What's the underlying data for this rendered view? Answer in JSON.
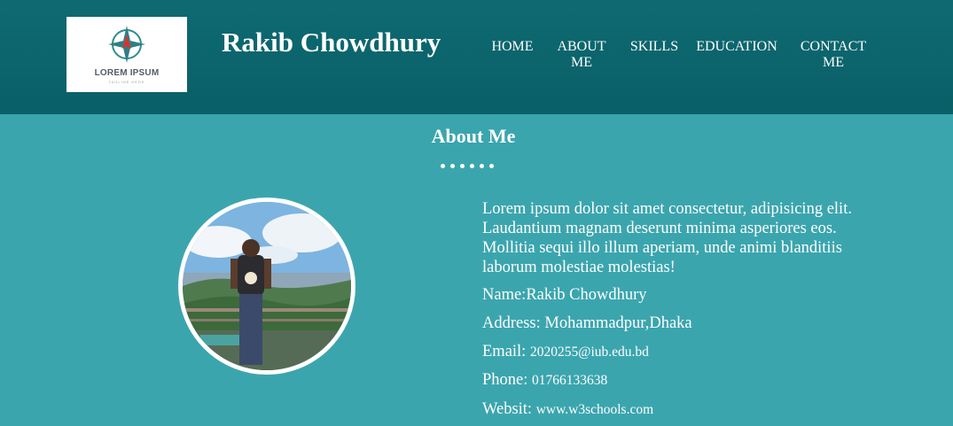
{
  "logo": {
    "text": "LOREM IPSUM",
    "subtext": "TAGLINE HERE"
  },
  "site": {
    "title": "Rakib Chowdhury"
  },
  "nav": {
    "home": "HOME",
    "about_line1": "ABOUT",
    "about_line2": "ME",
    "skills": "SKILLS",
    "education": "EDUCATION",
    "contact_line1": "CONTACT",
    "contact_line2": "ME"
  },
  "about": {
    "title": "About Me",
    "bio": "Lorem ipsum dolor sit amet consectetur, adipisicing elit. Laudantium magnam deserunt minima asperiores eos. Mollitia sequi illo illum aperiam, unde animi blanditiis laborum molestiae molestias!",
    "name_label": "Name:",
    "name_value": "Rakib Chowdhury",
    "address_label": "Address:",
    "address_value": "Mohammadpur,Dhaka",
    "email_label": "Email:",
    "email_value": "2020255@iub.edu.bd",
    "phone_label": "Phone:",
    "phone_value": "01766133638",
    "website_label": "Websit:",
    "website_value": "www.w3schools.com"
  },
  "colors": {
    "header": "#0e6a72",
    "body": "#3ba5ae",
    "text": "#ffffff"
  }
}
